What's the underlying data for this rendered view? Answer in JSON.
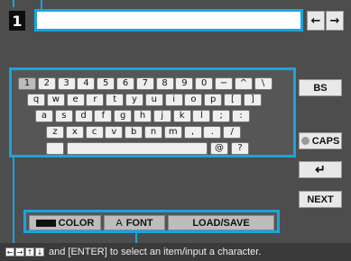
{
  "line_number": "1",
  "text_input": {
    "value": ""
  },
  "nav": {
    "left_icon": "arrow-left-icon",
    "right_icon": "arrow-right-icon",
    "left_glyph": "←",
    "right_glyph": "→"
  },
  "keyboard": {
    "row1": [
      "1",
      "2",
      "3",
      "4",
      "5",
      "6",
      "7",
      "8",
      "9",
      "0",
      "−",
      "^",
      "\\"
    ],
    "row2": [
      "q",
      "w",
      "e",
      "r",
      "t",
      "y",
      "u",
      "i",
      "o",
      "p",
      "[",
      "]"
    ],
    "row3": [
      "a",
      "s",
      "d",
      "f",
      "g",
      "h",
      "j",
      "k",
      "l",
      ";",
      ":"
    ],
    "row4": [
      "z",
      "x",
      "c",
      "v",
      "b",
      "n",
      "m",
      ",",
      ".",
      "/"
    ],
    "row5": [
      "",
      "",
      "@",
      "?"
    ]
  },
  "side": {
    "bs": "BS",
    "caps": "CAPS",
    "enter_glyph": "↵",
    "next": "NEXT"
  },
  "tabs": {
    "color": "COLOR",
    "font_glyph": "A",
    "font": "FONT",
    "load_save": "LOAD/SAVE"
  },
  "status": {
    "arrows": [
      "←",
      "→",
      "↑",
      "↓"
    ],
    "text": "and [ENTER] to select an item/input a character."
  },
  "colors": {
    "highlight": "#19a4e0"
  }
}
